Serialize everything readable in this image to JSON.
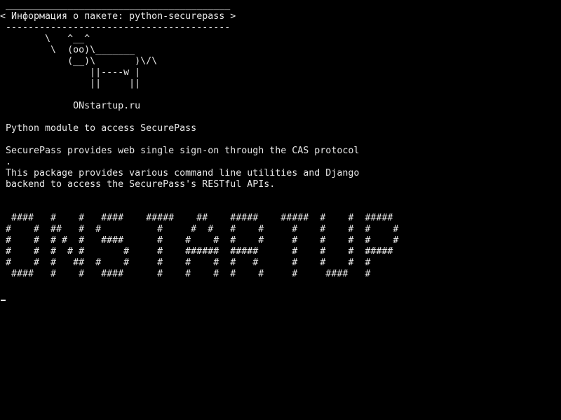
{
  "screen": {
    "cowsay_top_border": " ________________________________________",
    "cowsay_message": "< Информация о пакете: python-securepass >",
    "cowsay_bottom_border": " ----------------------------------------",
    "cow": [
      "        \\   ^__^",
      "         \\  (oo)\\_______",
      "            (__)\\       )\\/\\",
      "                ||----w |",
      "                ||     ||"
    ],
    "site_label": "             ONstartup.ru",
    "summary": "Python module to access SecurePass",
    "description": [
      "SecurePass provides web single sign-on through the CAS protocol",
      ".",
      "This package provides various command line utilities and Django",
      "backend to access the SecurePass's RESTful APIs."
    ],
    "banner": [
      " ####   #    #   ####    #####    ##    #####    #####  #    #  #####",
      "#    #  ##   #  #          #     #  #   #    #     #    #    #  #    #",
      "#    #  # #  #   ####      #    #    #  #    #     #    #    #  #    #",
      "#    #  #  # #       #     #    ######  #####      #    #    #  #####",
      "#    #  #   ##  #    #     #    #    #  #   #      #    #    #  #",
      " ####   #    #   ####      #    #    #  #    #     #     ####   #"
    ],
    "colors": {
      "background": "#000000",
      "foreground": "#e8e8e8"
    }
  }
}
